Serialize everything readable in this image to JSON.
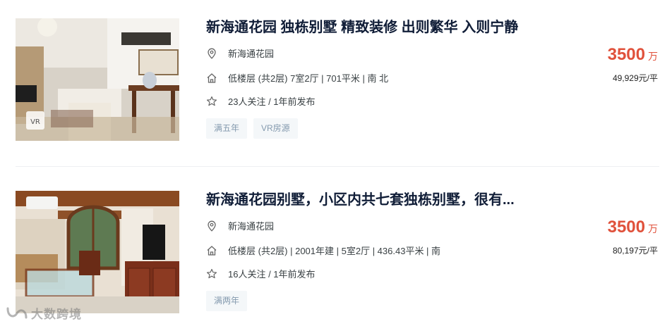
{
  "listings": [
    {
      "title": "新海通花园 独栋别墅 精致装修 出则繁华 入则宁静",
      "address": "新海通花园",
      "house_info": "低楼层 (共2层) 7室2厅 | 701平米 | 南 北",
      "follow_info": "23人关注 / 1年前发布",
      "tags": [
        "满五年",
        "VR房源"
      ],
      "total_price": "3500",
      "price_unit": "万",
      "unit_price": "49,929元/平",
      "photo_icon": "vr-badge-icon"
    },
    {
      "title": "新海通花园别墅，小区内共七套独栋别墅，很有...",
      "address": "新海通花园",
      "house_info": "低楼层 (共2层) | 2001年建 | 5室2厅 | 436.43平米 | 南",
      "follow_info": "16人关注 / 1年前发布",
      "tags": [
        "满两年"
      ],
      "total_price": "3500",
      "price_unit": "万",
      "unit_price": "80,197元/平"
    }
  ],
  "icons": {
    "address": "location-pin-icon",
    "house": "house-icon",
    "follow": "star-icon"
  },
  "colors": {
    "price": "#e0513b",
    "title": "#101d37",
    "tag_bg": "#f4f7f9",
    "tag_text": "#849aae"
  },
  "watermark": {
    "text": "大数跨境"
  }
}
